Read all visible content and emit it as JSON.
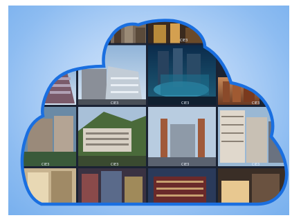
{
  "image": {
    "kind": "cloud-shaped photo collage",
    "subject": "city buildings and architecture photos arranged in a grid inside a cloud outline",
    "outline_color": "#1a6fe0",
    "background_color": "#a9cbf5",
    "tile_captions": [
      "CIE3",
      "CIE3",
      "CIE3",
      "CIE3",
      "CIE3",
      "CIE3",
      "CIE3",
      "CIE3"
    ]
  }
}
